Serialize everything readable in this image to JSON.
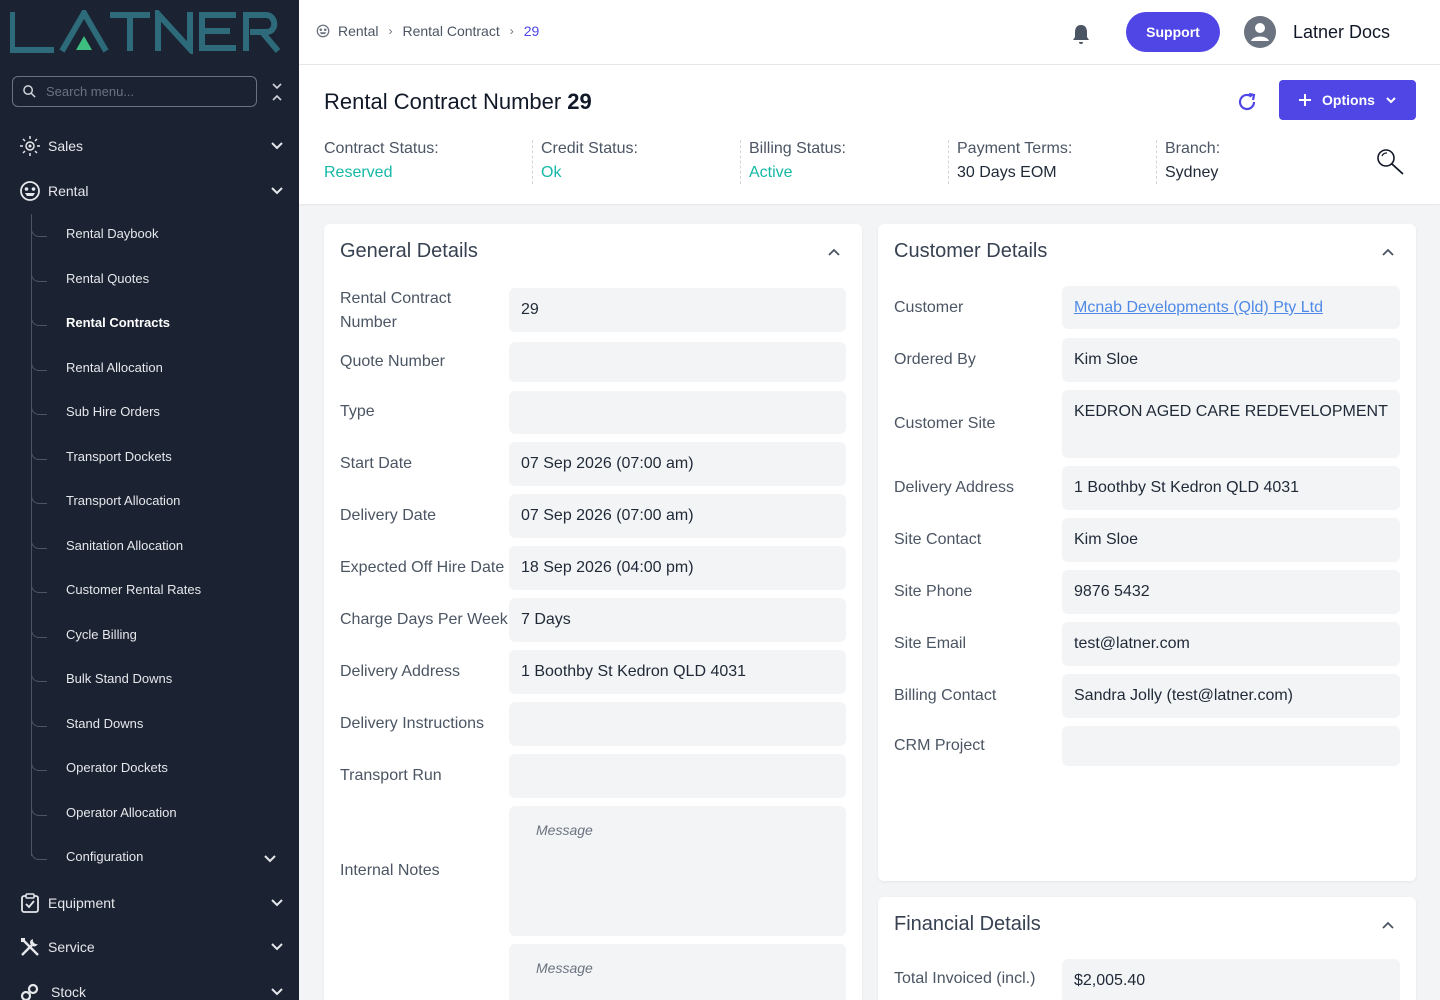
{
  "brand": {
    "logo_text": "LATNER"
  },
  "sidebar": {
    "search_placeholder": "Search menu...",
    "sections": {
      "sales": "Sales",
      "rental": "Rental",
      "equipment": "Equipment",
      "service": "Service",
      "stock": "Stock"
    },
    "rental_items": [
      "Rental Daybook",
      "Rental Quotes",
      "Rental Contracts",
      "Rental Allocation",
      "Sub Hire Orders",
      "Transport Dockets",
      "Transport Allocation",
      "Sanitation Allocation",
      "Customer Rental Rates",
      "Cycle Billing",
      "Bulk Stand Downs",
      "Stand Downs",
      "Operator Dockets",
      "Operator Allocation",
      "Configuration"
    ]
  },
  "header": {
    "breadcrumb": [
      "Rental",
      "Rental Contract",
      "29"
    ],
    "support_label": "Support",
    "user_name": "Latner Docs"
  },
  "contract": {
    "title": "Rental Contract Number",
    "number": "29",
    "options_label": "Options",
    "statuses": [
      {
        "label": "Contract Status:",
        "value": "Reserved"
      },
      {
        "label": "Credit Status:",
        "value": "Ok"
      },
      {
        "label": "Billing Status:",
        "value": "Active"
      },
      {
        "label": "Payment Terms:",
        "value": "30 Days EOM"
      },
      {
        "label": "Branch:",
        "value": "Sydney"
      }
    ]
  },
  "general": {
    "title": "General Details",
    "fields": [
      {
        "label": "Rental Contract Number",
        "value": "29"
      },
      {
        "label": "Quote Number",
        "value": ""
      },
      {
        "label": "Type",
        "value": ""
      },
      {
        "label": "Start Date",
        "value": "07 Sep 2026 (07:00 am)"
      },
      {
        "label": "Delivery Date",
        "value": "07 Sep 2026 (07:00 am)"
      },
      {
        "label": "Expected Off Hire Date",
        "value": "18 Sep 2026 (04:00 pm)"
      },
      {
        "label": "Charge Days Per Week",
        "value": "7 Days"
      },
      {
        "label": "Delivery Address",
        "value": "1 Boothby St Kedron QLD 4031"
      },
      {
        "label": "Delivery Instructions",
        "value": ""
      },
      {
        "label": "Transport Run",
        "value": ""
      },
      {
        "label": "Internal Notes",
        "placeholder": "Message"
      },
      {
        "placeholder": "Message"
      }
    ]
  },
  "customer": {
    "title": "Customer Details",
    "fields": [
      {
        "label": "Customer",
        "value": "Mcnab Developments (Qld) Pty Ltd"
      },
      {
        "label": "Ordered By",
        "value": "Kim Sloe"
      },
      {
        "label": "Customer Site",
        "value": "KEDRON AGED CARE REDEVELOPMENT"
      },
      {
        "label": "Delivery Address",
        "value": "1 Boothby St Kedron QLD 4031"
      },
      {
        "label": "Site Contact",
        "value": "Kim Sloe"
      },
      {
        "label": "Site Phone",
        "value": "9876 5432"
      },
      {
        "label": "Site Email",
        "value": "test@latner.com"
      },
      {
        "label": "Billing Contact",
        "value": "Sandra Jolly (test@latner.com)"
      },
      {
        "label": "CRM Project",
        "value": ""
      }
    ]
  },
  "financial": {
    "title": "Financial Details",
    "fields": [
      {
        "label": "Total Invoiced (incl.)",
        "value": "$2,005.40"
      }
    ]
  },
  "colors": {
    "sidebar_bg": "#1b2332",
    "accent": "#4f46e5",
    "status_teal": "#14b8a6",
    "link": "#4f8ae6",
    "logo_teal": "#2d6a7a",
    "logo_green": "#3fbf7f"
  }
}
